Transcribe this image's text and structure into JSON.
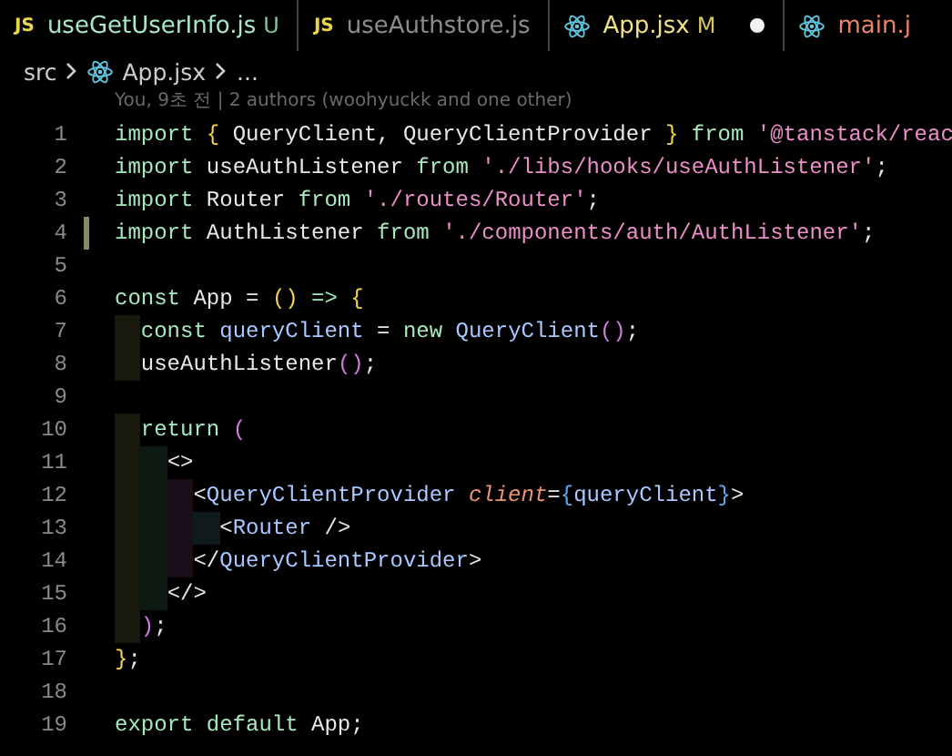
{
  "tabs": [
    {
      "badge": "JS",
      "label": "useGetUserInfo.js",
      "color": "#a8e6c4",
      "status": "U",
      "dirty": false
    },
    {
      "badge": "JS",
      "label": "useAuthstore.js",
      "color": "#8c8c8c",
      "dirty": false
    },
    {
      "label": "App.jsx",
      "color": "#f0e08a",
      "status": "M",
      "dirty": true
    },
    {
      "label": "main.j",
      "color": "#e9836a",
      "dirty": false
    }
  ],
  "breadcrumb": {
    "folder": "src",
    "file": "App.jsx",
    "more": "..."
  },
  "blame": "You, 9초 전 | 2 authors (woohyuckk and one other)",
  "lines": [
    {
      "number": "1",
      "modified": false,
      "tokens": [
        {
          "kind": "keyword",
          "text": "import "
        },
        {
          "kind": "brace",
          "text": "{"
        },
        {
          "kind": "plain",
          "text": " QueryClient, QueryClientProvider "
        },
        {
          "kind": "brace",
          "text": "}"
        },
        {
          "kind": "keyword",
          "text": " from "
        },
        {
          "kind": "string",
          "text": "'@tanstack/reac"
        }
      ]
    },
    {
      "number": "2",
      "modified": false,
      "tokens": [
        {
          "kind": "keyword",
          "text": "import"
        },
        {
          "kind": "plain",
          "text": " useAuthListener "
        },
        {
          "kind": "keyword",
          "text": "from "
        },
        {
          "kind": "string",
          "text": "'./libs/hooks/useAuthListener'"
        },
        {
          "kind": "plain",
          "text": ";"
        }
      ]
    },
    {
      "number": "3",
      "modified": false,
      "tokens": [
        {
          "kind": "keyword",
          "text": "import"
        },
        {
          "kind": "plain",
          "text": " Router "
        },
        {
          "kind": "keyword",
          "text": "from "
        },
        {
          "kind": "string",
          "text": "'./routes/Router'"
        },
        {
          "kind": "plain",
          "text": ";"
        }
      ]
    },
    {
      "number": "4",
      "modified": true,
      "tokens": [
        {
          "kind": "keyword",
          "text": "import"
        },
        {
          "kind": "plain",
          "text": " AuthListener "
        },
        {
          "kind": "keyword",
          "text": "from "
        },
        {
          "kind": "string",
          "text": "'./components/auth/AuthListener'"
        },
        {
          "kind": "plain",
          "text": ";"
        }
      ]
    },
    {
      "number": "5",
      "modified": false
    },
    {
      "number": "6",
      "modified": false,
      "tokens": [
        {
          "kind": "keyword",
          "text": "const"
        },
        {
          "kind": "plain",
          "text": " App = "
        },
        {
          "kind": "brace",
          "text": "() "
        },
        {
          "kind": "keyword",
          "text": "=> "
        },
        {
          "kind": "brace",
          "text": "{"
        }
      ]
    },
    {
      "number": "7",
      "modified": false,
      "tokens": [
        {
          "kind": "keyword",
          "text": "  const "
        },
        {
          "kind": "name",
          "text": "queryClient"
        },
        {
          "kind": "plain",
          "text": " = "
        },
        {
          "kind": "keyword",
          "text": "new "
        },
        {
          "kind": "name",
          "text": "QueryClient"
        },
        {
          "kind": "paren",
          "text": "()"
        },
        {
          "kind": "plain",
          "text": ";"
        }
      ]
    },
    {
      "number": "8",
      "modified": false,
      "tokens": [
        {
          "kind": "plain",
          "text": "  useAuthListener"
        },
        {
          "kind": "paren",
          "text": "()"
        },
        {
          "kind": "plain",
          "text": ";"
        }
      ]
    },
    {
      "number": "9",
      "modified": false
    },
    {
      "number": "10",
      "modified": false,
      "tokens": [
        {
          "kind": "keyword",
          "text": "  return "
        },
        {
          "kind": "paren",
          "text": "("
        }
      ]
    },
    {
      "number": "11",
      "modified": false,
      "tokens": [
        {
          "kind": "plain",
          "text": "    <>"
        }
      ]
    },
    {
      "number": "12",
      "modified": false,
      "tokens": [
        {
          "kind": "plain",
          "text": "      <"
        },
        {
          "kind": "name",
          "text": "QueryClientProvider "
        },
        {
          "kind": "attribute",
          "text": "client"
        },
        {
          "kind": "plain",
          "text": "="
        },
        {
          "kind": "bracket",
          "text": "{"
        },
        {
          "kind": "name",
          "text": "queryClient"
        },
        {
          "kind": "bracket",
          "text": "}"
        },
        {
          "kind": "plain",
          "text": ">"
        }
      ]
    },
    {
      "number": "13",
      "modified": false,
      "tokens": [
        {
          "kind": "plain",
          "text": "        <"
        },
        {
          "kind": "name",
          "text": "Router"
        },
        {
          "kind": "plain",
          "text": " />"
        }
      ]
    },
    {
      "number": "14",
      "modified": false,
      "tokens": [
        {
          "kind": "plain",
          "text": "      </"
        },
        {
          "kind": "name",
          "text": "QueryClientProvider"
        },
        {
          "kind": "plain",
          "text": ">"
        }
      ]
    },
    {
      "number": "15",
      "modified": false,
      "tokens": [
        {
          "kind": "plain",
          "text": "    </>"
        }
      ]
    },
    {
      "number": "16",
      "modified": false,
      "tokens": [
        {
          "kind": "paren",
          "text": "  )"
        },
        {
          "kind": "plain",
          "text": ";"
        }
      ]
    },
    {
      "number": "17",
      "modified": false,
      "tokens": [
        {
          "kind": "brace",
          "text": "}"
        },
        {
          "kind": "plain",
          "text": ";"
        }
      ]
    },
    {
      "number": "18",
      "modified": false
    },
    {
      "number": "19",
      "modified": false,
      "tokens": [
        {
          "kind": "keyword",
          "text": "export default"
        },
        {
          "kind": "plain",
          "text": " App;"
        }
      ]
    }
  ]
}
